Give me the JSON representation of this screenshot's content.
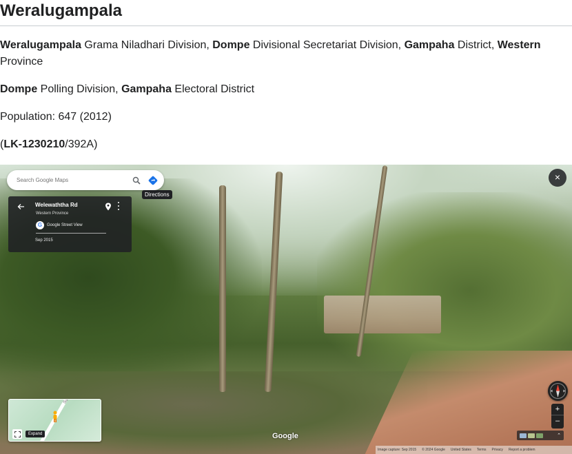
{
  "page": {
    "title": "Weralugampala",
    "line1": {
      "gn_name": "Weralugampala",
      "gn_label": " Grama Niladhari Division, ",
      "ds_name": "Dompe",
      "ds_label": " Divisional Secretariat Division, ",
      "district_name": "Gampaha",
      "district_label": " District, ",
      "province_name": "Western",
      "province_label": " Province"
    },
    "line2": {
      "polling_name": "Dompe",
      "polling_label": " Polling Division, ",
      "electoral_name": "Gampaha",
      "electoral_label": " Electoral District"
    },
    "population_text": "Population: 647 (2012)",
    "code": {
      "open": "(",
      "id": "LK-1230210",
      "rest": "/392A)"
    }
  },
  "street_view": {
    "search_placeholder": "Search Google Maps",
    "directions_tooltip": "Directions",
    "place_title": "Welewaththa Rd",
    "place_subtitle": "Western Province",
    "service_label": "Google Street View",
    "capture_date": "Sep 2015",
    "close_symbol": "×",
    "zoom_in": "+",
    "zoom_out": "–",
    "minimap_road_label": "Sakura Mw",
    "expand_label": "Expand",
    "google_logo": "Google",
    "layers_chevron": "⌃",
    "footer": {
      "image_capture": "Image capture: Sep 2015",
      "copyright": "© 2024 Google",
      "country": "United States",
      "terms": "Terms",
      "privacy": "Privacy",
      "report": "Report a problem"
    },
    "colors": {
      "panel_bg": "#202124",
      "accent_blue": "#1a73e8",
      "compass_red": "#ea4335"
    }
  }
}
